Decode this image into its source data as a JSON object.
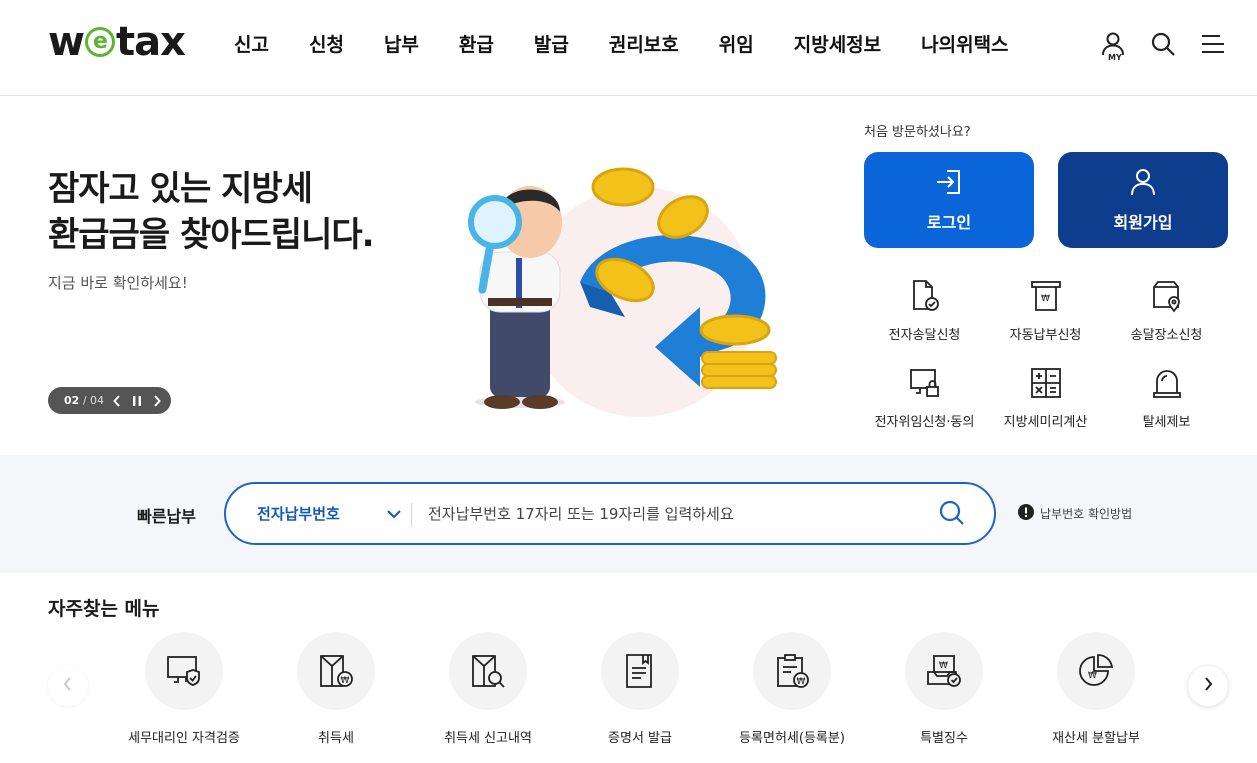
{
  "header": {
    "logo": {
      "pre": "w",
      "mid": "e",
      "post": "tax"
    },
    "nav": [
      "신고",
      "신청",
      "납부",
      "환급",
      "발급",
      "권리보호",
      "위임",
      "지방세정보",
      "나의위택스"
    ],
    "my_label": "MY"
  },
  "hero": {
    "title_line1": "잠자고 있는 지방세",
    "title_line2": "환급금을 찾아드립니다.",
    "subtitle": "지금 바로 확인하세요!",
    "slide_current": "02",
    "slide_total": "/ 04"
  },
  "member": {
    "welcome": "처음 방문하셨나요?",
    "login_label": "로그인",
    "join_label": "회원가입",
    "quick_links": [
      {
        "label": "전자송달신청",
        "icon": "document-check-icon"
      },
      {
        "label": "자동납부신청",
        "icon": "auto-pay-icon"
      },
      {
        "label": "송달장소신청",
        "icon": "location-bag-icon"
      },
      {
        "label": "전자위임신청·동의",
        "icon": "monitor-lock-icon"
      },
      {
        "label": "지방세미리계산",
        "icon": "calculator-icon"
      },
      {
        "label": "탈세제보",
        "icon": "siren-icon"
      }
    ]
  },
  "quick_pay": {
    "label": "빠른납부",
    "select_value": "전자납부번호",
    "placeholder": "전자납부번호 17자리 또는 19자리를 입력하세요",
    "help_text": "납부번호 확인방법"
  },
  "frequent": {
    "title": "자주찾는 메뉴",
    "items": [
      {
        "label": "세무대리인 자격검증",
        "icon": "monitor-shield-icon"
      },
      {
        "label": "취득세",
        "icon": "acquisition-tax-icon"
      },
      {
        "label": "취득세 신고내역",
        "icon": "report-search-icon"
      },
      {
        "label": "증명서 발급",
        "icon": "certificate-icon"
      },
      {
        "label": "등록면허세(등록분)",
        "icon": "clipboard-won-icon"
      },
      {
        "label": "특별징수",
        "icon": "special-collection-icon"
      },
      {
        "label": "재산세 분할납부",
        "icon": "pie-won-icon"
      }
    ]
  },
  "colors": {
    "primary": "#0a65d8",
    "navy": "#0d3d8c",
    "logo_green": "#5cb532",
    "band_bg": "#f4f6f9"
  }
}
